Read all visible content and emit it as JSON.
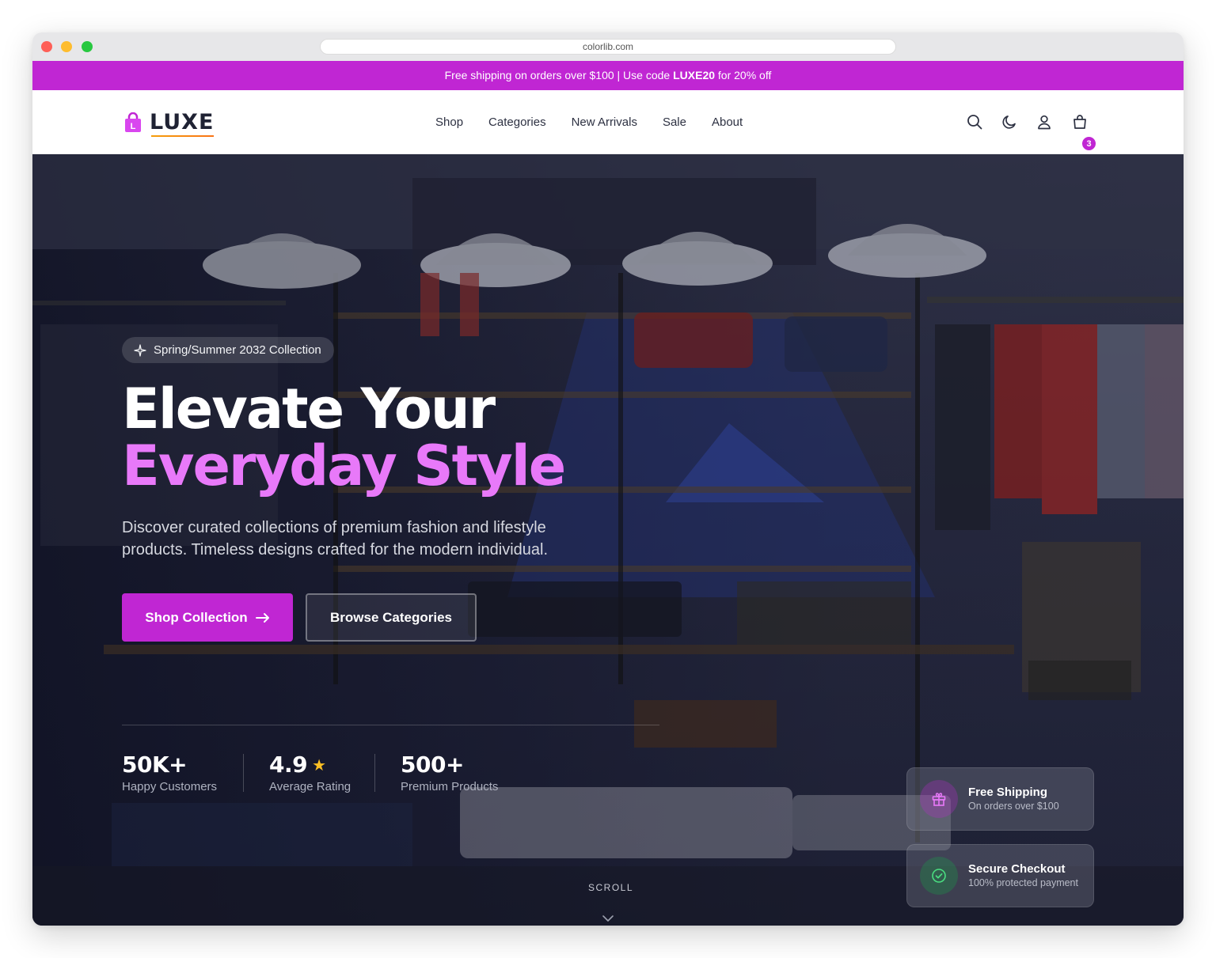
{
  "browser": {
    "url": "colorlib.com"
  },
  "promo": {
    "text_before": "Free shipping on orders over $100 | Use code ",
    "code": "LUXE20",
    "text_after": " for 20% off"
  },
  "header": {
    "logo_text": "LUXE",
    "nav": [
      "Shop",
      "Categories",
      "New Arrivals",
      "Sale",
      "About"
    ],
    "icons": [
      "search-icon",
      "moon-icon",
      "user-icon",
      "shopping-bag-icon"
    ],
    "cart_count": "3"
  },
  "hero": {
    "badge": "Spring/Summer 2032 Collection",
    "title_line1": "Elevate Your",
    "title_line2": "Everyday Style",
    "subtitle": "Discover curated collections of premium fashion and lifestyle products. Timeless designs crafted for the modern individual.",
    "primary_button": "Shop Collection",
    "secondary_button": "Browse Categories",
    "stats": [
      {
        "value": "50K+",
        "label": "Happy Customers"
      },
      {
        "value": "4.9",
        "label": "Average Rating",
        "star": "★"
      },
      {
        "value": "500+",
        "label": "Premium Products"
      }
    ],
    "features": [
      {
        "title": "Free Shipping",
        "subtitle": "On orders over $100",
        "icon": "gift-icon"
      },
      {
        "title": "Secure Checkout",
        "subtitle": "100% protected payment",
        "icon": "check-circle-icon"
      }
    ],
    "scroll_label": "SCROLL"
  },
  "colors": {
    "accent": "#c026d3",
    "accent_light": "#e879f9",
    "star": "#fbbf24",
    "header_text": "#2d3142"
  }
}
